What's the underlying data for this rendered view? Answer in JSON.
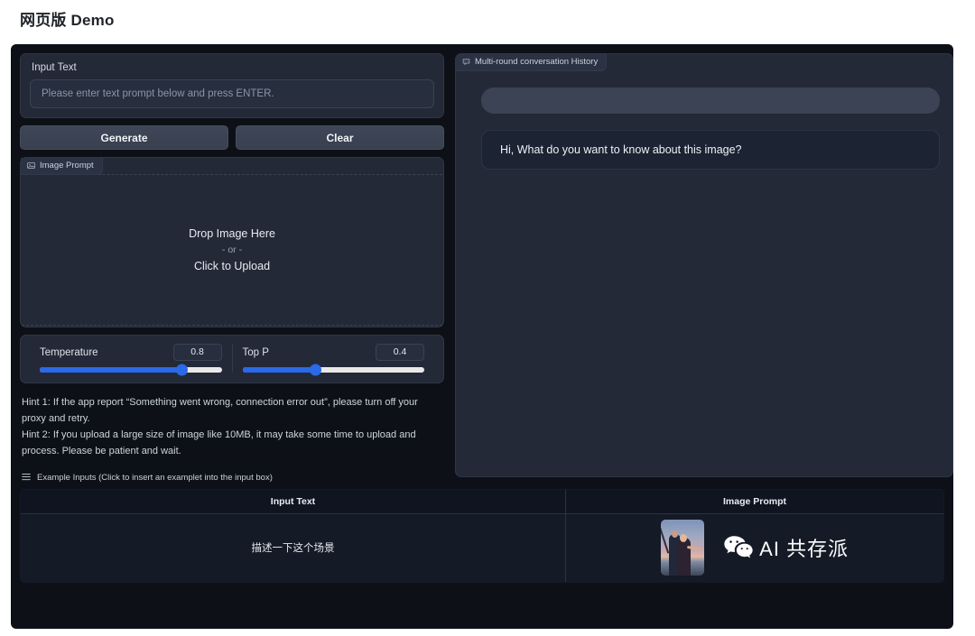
{
  "page": {
    "title": "网页版 Demo"
  },
  "left": {
    "input_block": {
      "label": "Input Text",
      "placeholder": "Please enter text prompt below and press ENTER.",
      "value": ""
    },
    "buttons": {
      "generate": "Generate",
      "clear": "Clear"
    },
    "image_prompt": {
      "tab_label": "Image Prompt",
      "tab_icon": "image-icon",
      "drop_main": "Drop Image Here",
      "drop_or": "- or -",
      "drop_click": "Click to Upload"
    },
    "sliders": [
      {
        "name": "Temperature",
        "value": "0.8",
        "percent": 78
      },
      {
        "name": "Top P",
        "value": "0.4",
        "percent": 40
      }
    ],
    "hints": [
      "Hint 1: If the app report “Something went wrong, connection error out”, please turn off your proxy and retry.",
      "Hint 2: If you upload a large size of image like 10MB, it may take some time to upload and process. Please be patient and wait."
    ],
    "examples_header": {
      "icon": "hamburger-icon",
      "label": "Example Inputs (Click to insert an examplet into the input box)"
    }
  },
  "right": {
    "chat": {
      "tab_label": "Multi-round conversation History",
      "tab_icon": "chat-bubble-icon",
      "messages": [
        {
          "role": "user",
          "text": ""
        },
        {
          "role": "assistant",
          "text": "Hi, What do you want to know about this image?"
        }
      ]
    }
  },
  "examples_table": {
    "columns": [
      "Input Text",
      "Image Prompt"
    ],
    "rows": [
      {
        "input_text": "描述一下这个场景",
        "image_prompt": "titanic-scene-thumbnail"
      }
    ]
  },
  "watermark": {
    "icon": "wechat-icon",
    "text": "AI 共存派"
  },
  "colors": {
    "accent": "#2a69e8",
    "app_background": "#0d1117",
    "panel_background": "#232937",
    "panel_border": "#2f3646",
    "page_background": "#ffffff",
    "title_text": "#1f2328"
  }
}
